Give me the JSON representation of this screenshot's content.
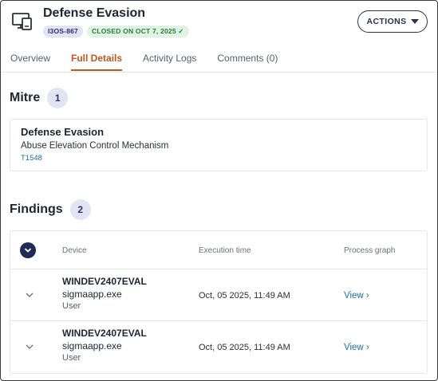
{
  "header": {
    "icon": "monitor-device-icon",
    "title": "Defense Evasion",
    "id_badge": "I3OS-867",
    "status_badge": "CLOSED ON OCT 7, 2025 ✓",
    "actions_label": "ACTIONS"
  },
  "tabs": [
    {
      "label": "Overview",
      "active": false
    },
    {
      "label": "Full Details",
      "active": true
    },
    {
      "label": "Activity Logs",
      "active": false
    },
    {
      "label": "Comments (0)",
      "active": false
    }
  ],
  "mitre": {
    "title": "Mitre",
    "count": "1",
    "tactic": "Defense Evasion",
    "technique": "Abuse Elevation Control Mechanism",
    "technique_id": "T1548"
  },
  "findings": {
    "title": "Findings",
    "count": "2",
    "columns": {
      "device": "Device",
      "time": "Execution time",
      "graph": "Process graph"
    },
    "rows": [
      {
        "host": "WINDEV2407EVAL",
        "process": "sigmaapp.exe",
        "user": "User",
        "time": "Oct, 05 2025, 11:49 AM",
        "view": "View ›"
      },
      {
        "host": "WINDEV2407EVAL",
        "process": "sigmaapp.exe",
        "user": "User",
        "time": "Oct, 05 2025, 11:49 AM",
        "view": "View ›"
      }
    ]
  },
  "colors": {
    "accent": "#c0561a",
    "link": "#1c6fa8",
    "navy": "#1f2a55",
    "badge_bg": "#e2e4f3"
  }
}
